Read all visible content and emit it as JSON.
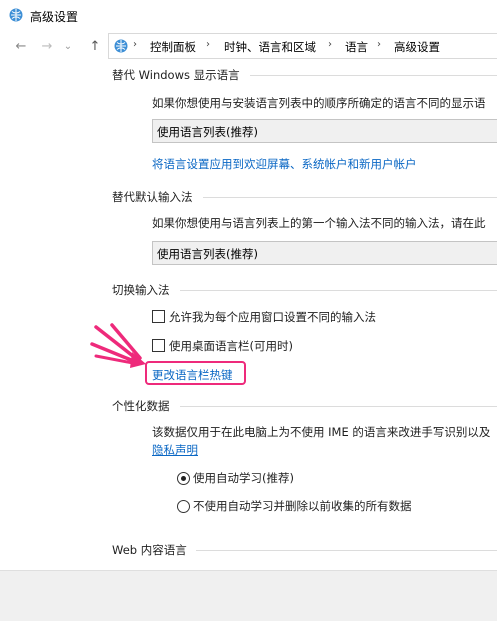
{
  "window": {
    "title": "高级设置"
  },
  "nav": {
    "back_icon": "←",
    "forward_icon": "→",
    "dropdown_icon": "⌄",
    "up_icon": "↑"
  },
  "breadcrumb": [
    "控制面板",
    "时钟、语言和区域",
    "语言",
    "高级设置"
  ],
  "sections": {
    "display_language": {
      "title": "替代 Windows 显示语言",
      "desc": "如果你想使用与安装语言列表中的顺序所确定的语言不同的显示语",
      "select_value": "使用语言列表(推荐)",
      "link": "将语言设置应用到欢迎屏幕、系统帐户和新用户帐户"
    },
    "input_method": {
      "title": "替代默认输入法",
      "desc": "如果你想使用与语言列表上的第一个输入法不同的输入法，请在此",
      "select_value": "使用语言列表(推荐)"
    },
    "switch_input": {
      "title": "切换输入法",
      "option1": "允许我为每个应用窗口设置不同的输入法",
      "option2": "使用桌面语言栏(可用时)",
      "link": "更改语言栏热键"
    },
    "personalization": {
      "title": "个性化数据",
      "desc": "该数据仅用于在此电脑上为不使用 IME 的语言来改进手写识别以及",
      "privacy_link": "隐私声明",
      "radio1": "使用自动学习(推荐)",
      "radio2": "不使用自动学习并删除以前收集的所有数据",
      "radio1_selected": true
    },
    "web_language": {
      "title": "Web 内容语言"
    }
  },
  "colors": {
    "link": "#0a67c4",
    "highlight": "#ee2a7b"
  }
}
